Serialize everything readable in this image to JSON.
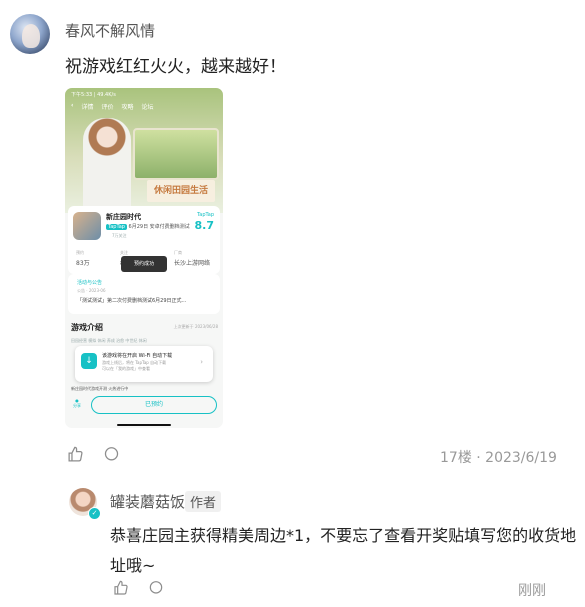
{
  "post": {
    "username": "春风不解风情",
    "comment": "祝游戏红红火火，越来越好！",
    "floor_meta": "17楼 · 2023/6/19"
  },
  "shot": {
    "status": "下午5:33 | 49.4K/s",
    "nav": [
      "详情",
      "评价",
      "攻略",
      "论坛"
    ],
    "banner": "休闲田园生活",
    "game_name": "新庄园时代",
    "game_line_tag": "TapTap",
    "game_line_text": "6月29日 安卓付费删档测试",
    "follow": "7万关注",
    "score_label": "TapTap",
    "score": "8.7",
    "stats": [
      {
        "label": "预约",
        "value": "83万"
      },
      {
        "label": "关注",
        "value": "8万"
      },
      {
        "label": "厂商",
        "value": "长沙上游网络"
      }
    ],
    "toast": "预约成功",
    "notice_title": "活动与公告",
    "notice_meta": "公告 · 2023-06",
    "notice_body": "「测试测试」第二次付费删档测试6月29日正式...",
    "intro_title": "游戏介绍",
    "intro_right": "上次更新于 2023/06/28",
    "tags": "田园经营  模拟  休闲  养成  治愈  中世纪  休闲",
    "popup_icon": "↓",
    "popup_title": "该游戏将在开启 Wi-Fi 自动下载",
    "popup_desc": "游戏上线后，将在 TapTap 自动下载\n可以在「我的游戏」中查看",
    "popup_close": "›",
    "bottom_text": "新庄园时代游戏开测 火热进行中",
    "share_label": "分享",
    "action_button": "已预约"
  },
  "reply": {
    "username": "罐装蘑菇饭",
    "author_tag": "作者",
    "text": "恭喜庄园主获得精美周边*1，不要忘了查看开奖贴填写您的收货地址哦~",
    "time": "刚刚",
    "badge": "✓"
  },
  "icons": {
    "like": "thumbs-up-icon",
    "comment": "comment-bubble-icon"
  }
}
